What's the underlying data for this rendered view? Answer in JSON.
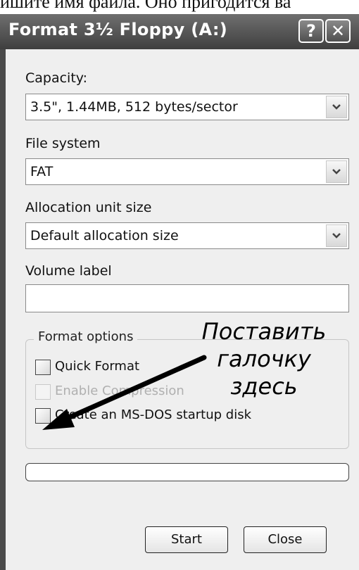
{
  "background_text": "ишите имя файла. Оно пригодится ва",
  "window": {
    "title": "Format 3½ Floppy (A:)",
    "help_button": "?",
    "close_button": "✕"
  },
  "capacity": {
    "label": "Capacity:",
    "value": "3.5\",  1.44MB, 512 bytes/sector"
  },
  "file_system": {
    "label": "File system",
    "value": "FAT"
  },
  "allocation": {
    "label": "Allocation unit size",
    "value": "Default allocation size"
  },
  "volume_label": {
    "label": "Volume label",
    "value": ""
  },
  "format_options": {
    "legend": "Format options",
    "options": [
      {
        "label": "Quick Format",
        "checked": false,
        "enabled": true
      },
      {
        "label": "Enable Compression",
        "checked": false,
        "enabled": false
      },
      {
        "label": "Create an MS-DOS startup disk",
        "checked": false,
        "enabled": true
      }
    ]
  },
  "annotation": {
    "line1": "Поставить",
    "line2": "галочку",
    "line3": "здесь"
  },
  "progress": {
    "fraction": 0
  },
  "buttons": {
    "start": "Start",
    "close": "Close"
  }
}
